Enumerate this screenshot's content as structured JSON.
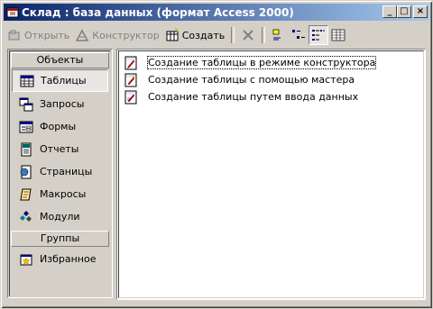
{
  "window": {
    "title": "Склад : база данных (формат Access 2000)",
    "controls": {
      "minimize": "_",
      "maximize": "□",
      "close": "×"
    }
  },
  "toolbar": {
    "open_label": "Открыть",
    "design_label": "Конструктор",
    "create_label": "Создать",
    "delete_icon": "delete-icon",
    "view_modes": [
      "large-icons",
      "small-icons",
      "list",
      "details"
    ],
    "active_view": "list"
  },
  "sidebar": {
    "objects_header": "Объекты",
    "items": [
      {
        "label": "Таблицы",
        "icon": "table-icon",
        "selected": true
      },
      {
        "label": "Запросы",
        "icon": "query-icon"
      },
      {
        "label": "Формы",
        "icon": "form-icon"
      },
      {
        "label": "Отчеты",
        "icon": "report-icon"
      },
      {
        "label": "Страницы",
        "icon": "page-icon"
      },
      {
        "label": "Макросы",
        "icon": "macro-icon"
      },
      {
        "label": "Модули",
        "icon": "module-icon"
      }
    ],
    "groups_header": "Группы",
    "group_items": [
      {
        "label": "Избранное",
        "icon": "favorites-icon"
      }
    ]
  },
  "content": {
    "shortcuts": [
      {
        "label": "Создание таблицы в режиме конструктора",
        "icon": "design-shortcut-icon"
      },
      {
        "label": "Создание таблицы с помощью мастера",
        "icon": "wizard-shortcut-icon"
      },
      {
        "label": "Создание таблицы путем ввода данных",
        "icon": "entry-shortcut-icon"
      }
    ]
  },
  "colors": {
    "title_start": "#0a246a",
    "title_end": "#a6caf0",
    "face": "#d4d0c8"
  }
}
